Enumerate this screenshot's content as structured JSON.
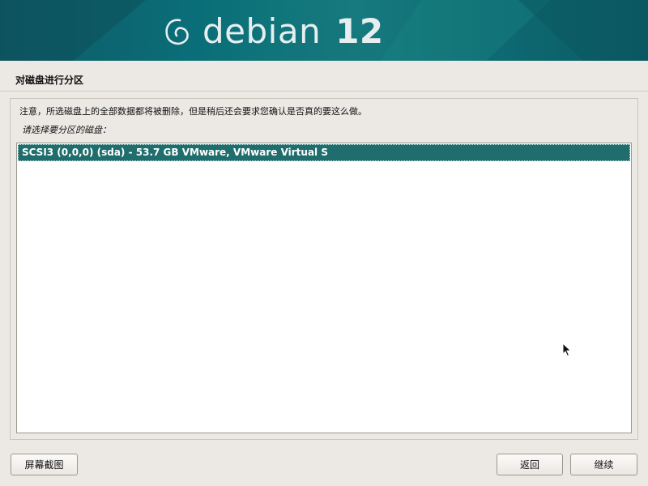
{
  "banner": {
    "brand": "debian",
    "version": "12",
    "logo_icon": "debian-swirl-icon"
  },
  "page": {
    "title": "对磁盘进行分区",
    "notice": "注意，所选磁盘上的全部数据都将被删除，但是稍后还会要求您确认是否真的要这么做。",
    "prompt": "请选择要分区的磁盘："
  },
  "disks": {
    "items": [
      {
        "label": "SCSI3 (0,0,0) (sda) - 53.7 GB VMware, VMware Virtual S",
        "selected": true
      }
    ]
  },
  "buttons": {
    "screenshot": "屏幕截图",
    "back": "返回",
    "continue": "继续"
  },
  "colors": {
    "banner": "#0a6e78",
    "selection": "#1f6d6d",
    "background": "#ece9e4"
  }
}
